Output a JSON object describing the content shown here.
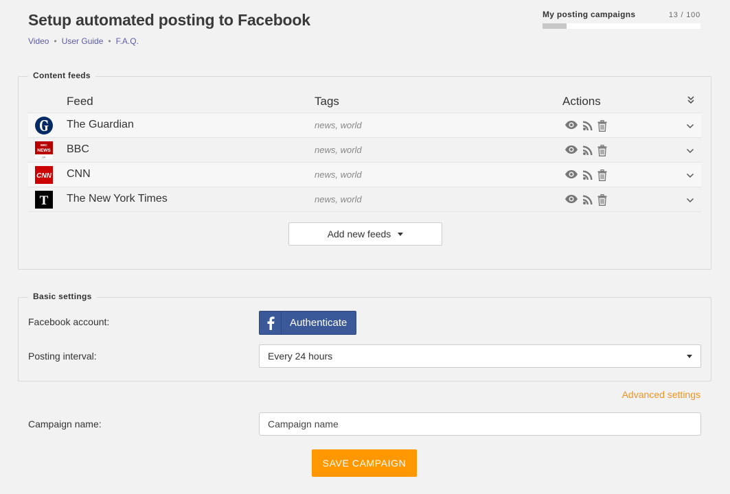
{
  "header": {
    "title": "Setup automated posting to Facebook",
    "links": [
      "Video",
      "User Guide",
      "F.A.Q."
    ]
  },
  "quota": {
    "label": "My posting campaigns",
    "count_text": "13 / 100",
    "used": 13,
    "total": 100
  },
  "content_feeds": {
    "legend": "Content feeds",
    "columns": {
      "feed": "Feed",
      "tags": "Tags",
      "actions": "Actions"
    },
    "rows": [
      {
        "name": "The Guardian",
        "tags": "news, world",
        "logo": "guardian-logo"
      },
      {
        "name": "BBC",
        "tags": "news, world",
        "logo": "bbc-news-logo"
      },
      {
        "name": "CNN",
        "tags": "news, world",
        "logo": "cnn-logo"
      },
      {
        "name": "The New York Times",
        "tags": "news, world",
        "logo": "nyt-logo"
      }
    ],
    "add_button": "Add new feeds"
  },
  "basic_settings": {
    "legend": "Basic settings",
    "facebook_label": "Facebook account:",
    "authenticate_label": "Authenticate",
    "interval_label": "Posting interval:",
    "interval_value": "Every 24 hours"
  },
  "advanced_link": "Advanced settings",
  "campaign": {
    "label": "Campaign name:",
    "placeholder": "Campaign name"
  },
  "save_button": "SAVE CAMPAIGN",
  "colors": {
    "accent": "#ff9800",
    "link": "#5a5aa8",
    "facebook": "#3b5998",
    "advanced_link": "#f0931e"
  }
}
